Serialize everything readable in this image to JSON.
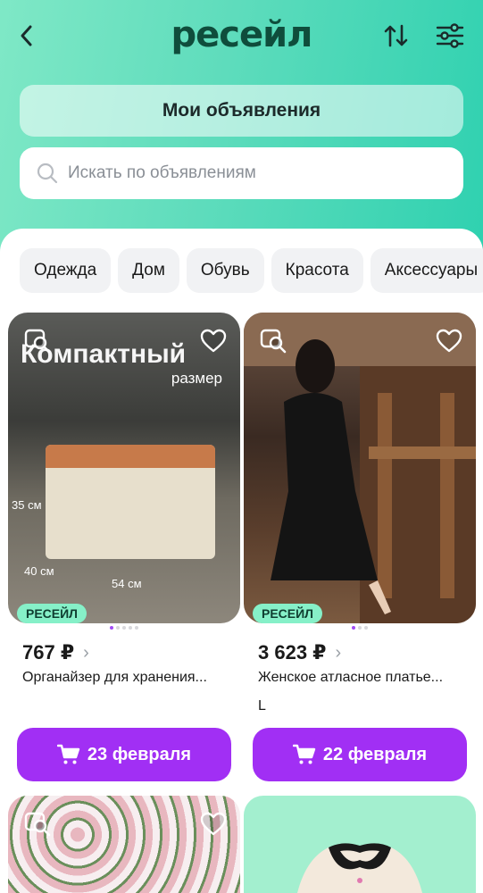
{
  "header": {
    "logo": "ресейл"
  },
  "my_ads_label": "Мои объявления",
  "search": {
    "placeholder": "Искать по объявлениям"
  },
  "categories": [
    "Одежда",
    "Дом",
    "Обувь",
    "Красота",
    "Аксессуары"
  ],
  "products": [
    {
      "price": "767 ₽",
      "title": "Органайзер для хранения...",
      "size": "",
      "badge": "РЕСЕЙЛ",
      "delivery": "23 февраля",
      "image_text": [
        "Компактный",
        "размер"
      ],
      "dimensions": [
        "35 см",
        "40 см",
        "54 см"
      ]
    },
    {
      "price": "3 623 ₽",
      "title": "Женское атласное платье...",
      "size": "L",
      "badge": "РЕСЕЙЛ",
      "delivery": "22 февраля"
    }
  ],
  "colors": {
    "brand_mint": "#5edcbc",
    "logo": "#0f4d3c",
    "accent_purple": "#a12ff4",
    "badge": "#86f0c8"
  },
  "icons": [
    "back-arrow-icon",
    "sort-icon",
    "filter-sliders-icon",
    "search-icon",
    "image-search-icon",
    "heart-icon",
    "cart-icon",
    "chevron-right-icon"
  ]
}
